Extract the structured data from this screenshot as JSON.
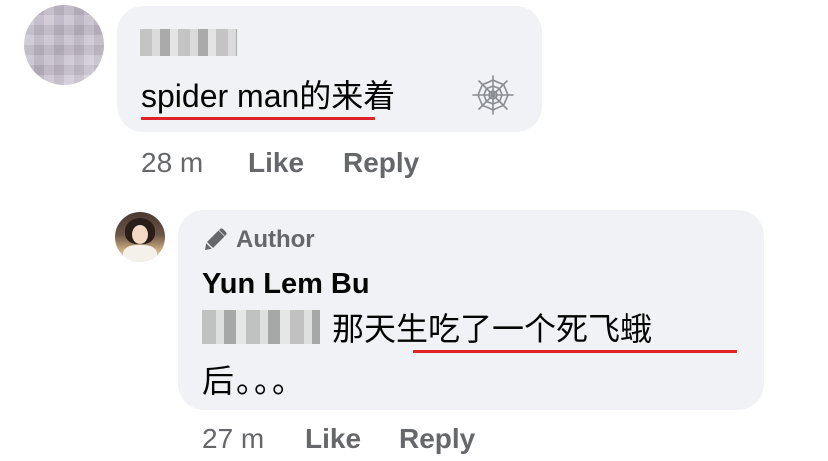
{
  "comment": {
    "text": "spider man的来着",
    "meta": {
      "time": "28 m",
      "like": "Like",
      "reply": "Reply"
    },
    "icons": {
      "emoji": "spider-web-icon"
    }
  },
  "reply": {
    "badge": "Author",
    "author_name": "Yun Lem Bu",
    "line1": "那天生吃了一个死飞蛾",
    "line2": "后。。。",
    "meta": {
      "time": "27 m",
      "like": "Like",
      "reply": "Reply"
    },
    "icons": {
      "badge_icon": "pencil-mic-icon"
    }
  },
  "colors": {
    "bubble": "#f0f2f5",
    "meta_text": "#65676b",
    "underline": "#e0242a",
    "text": "#050505"
  }
}
